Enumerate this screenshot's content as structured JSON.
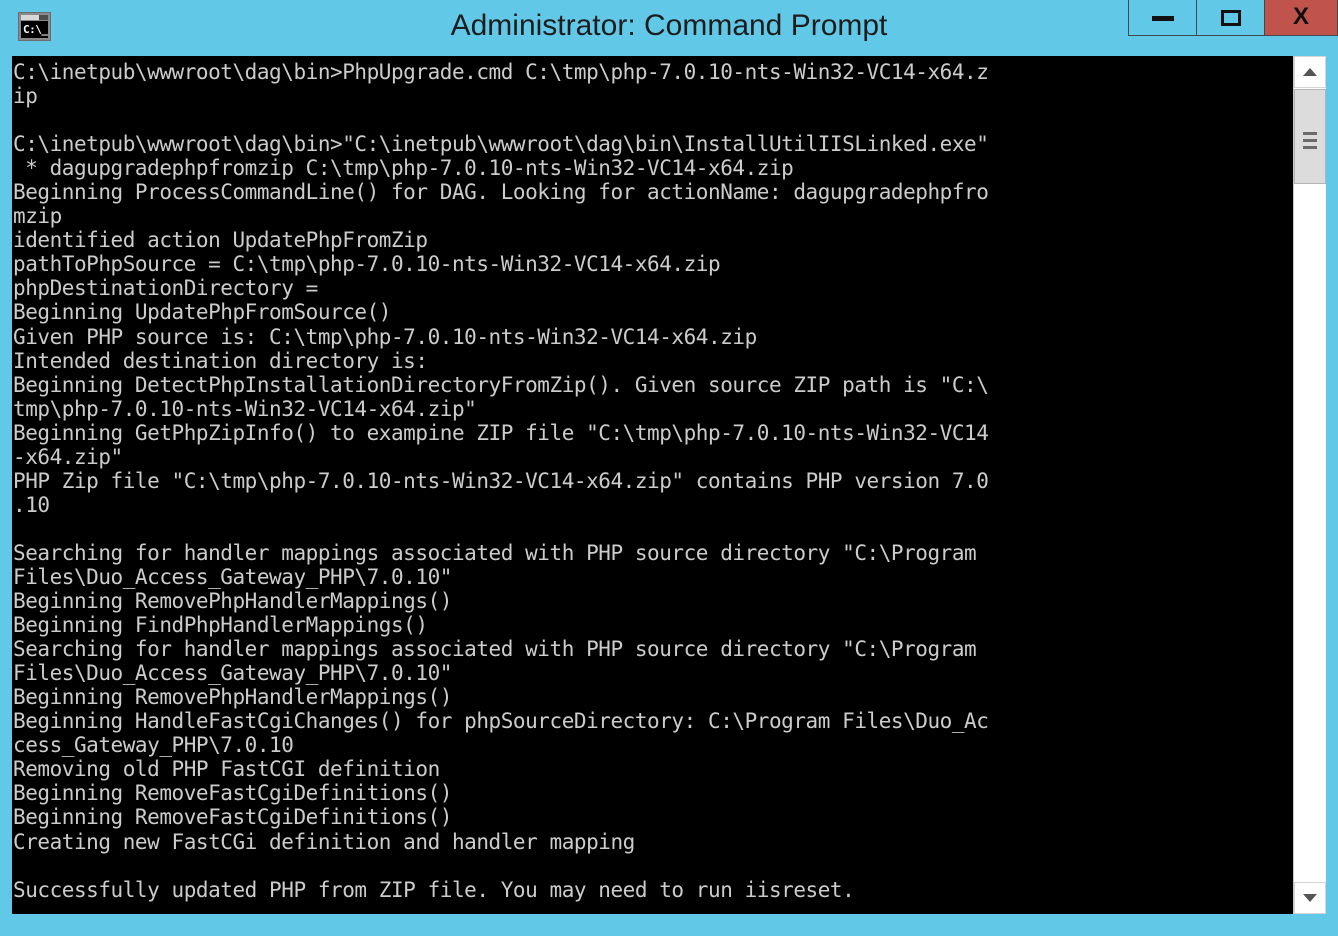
{
  "window": {
    "title": "Administrator: Command Prompt",
    "icon_label": "C:\\_",
    "icon_name": "command-prompt-icon",
    "colors": {
      "titlebar": "#62c8e8",
      "close_button": "#c0544c",
      "console_background": "#000000",
      "console_text": "#cccccc"
    }
  },
  "controls": {
    "minimize_label": "",
    "maximize_label": "",
    "close_label": "X"
  },
  "scrollbar": {
    "up_arrow_label": "",
    "down_arrow_label": "",
    "thumb_position_percent": 4
  },
  "console": {
    "lines": [
      "C:\\inetpub\\wwwroot\\dag\\bin>PhpUpgrade.cmd C:\\tmp\\php-7.0.10-nts-Win32-VC14-x64.z",
      "ip",
      "",
      "C:\\inetpub\\wwwroot\\dag\\bin>\"C:\\inetpub\\wwwroot\\dag\\bin\\InstallUtilIISLinked.exe\"",
      " * dagupgradephpfromzip C:\\tmp\\php-7.0.10-nts-Win32-VC14-x64.zip",
      "Beginning ProcessCommandLine() for DAG. Looking for actionName: dagupgradephpfro",
      "mzip",
      "identified action UpdatePhpFromZip",
      "pathToPhpSource = C:\\tmp\\php-7.0.10-nts-Win32-VC14-x64.zip",
      "phpDestinationDirectory =",
      "Beginning UpdatePhpFromSource()",
      "Given PHP source is: C:\\tmp\\php-7.0.10-nts-Win32-VC14-x64.zip",
      "Intended destination directory is:",
      "Beginning DetectPhpInstallationDirectoryFromZip(). Given source ZIP path is \"C:\\",
      "tmp\\php-7.0.10-nts-Win32-VC14-x64.zip\"",
      "Beginning GetPhpZipInfo() to exampine ZIP file \"C:\\tmp\\php-7.0.10-nts-Win32-VC14",
      "-x64.zip\"",
      "PHP Zip file \"C:\\tmp\\php-7.0.10-nts-Win32-VC14-x64.zip\" contains PHP version 7.0",
      ".10",
      "",
      "Searching for handler mappings associated with PHP source directory \"C:\\Program",
      "Files\\Duo_Access_Gateway_PHP\\7.0.10\"",
      "Beginning RemovePhpHandlerMappings()",
      "Beginning FindPhpHandlerMappings()",
      "Searching for handler mappings associated with PHP source directory \"C:\\Program",
      "Files\\Duo_Access_Gateway_PHP\\7.0.10\"",
      "Beginning RemovePhpHandlerMappings()",
      "Beginning HandleFastCgiChanges() for phpSourceDirectory: C:\\Program Files\\Duo_Ac",
      "cess_Gateway_PHP\\7.0.10",
      "Removing old PHP FastCGI definition",
      "Beginning RemoveFastCgiDefinitions()",
      "Beginning RemoveFastCgiDefinitions()",
      "Creating new FastCGi definition and handler mapping",
      "",
      "Successfully updated PHP from ZIP file. You may need to run iisreset."
    ]
  }
}
